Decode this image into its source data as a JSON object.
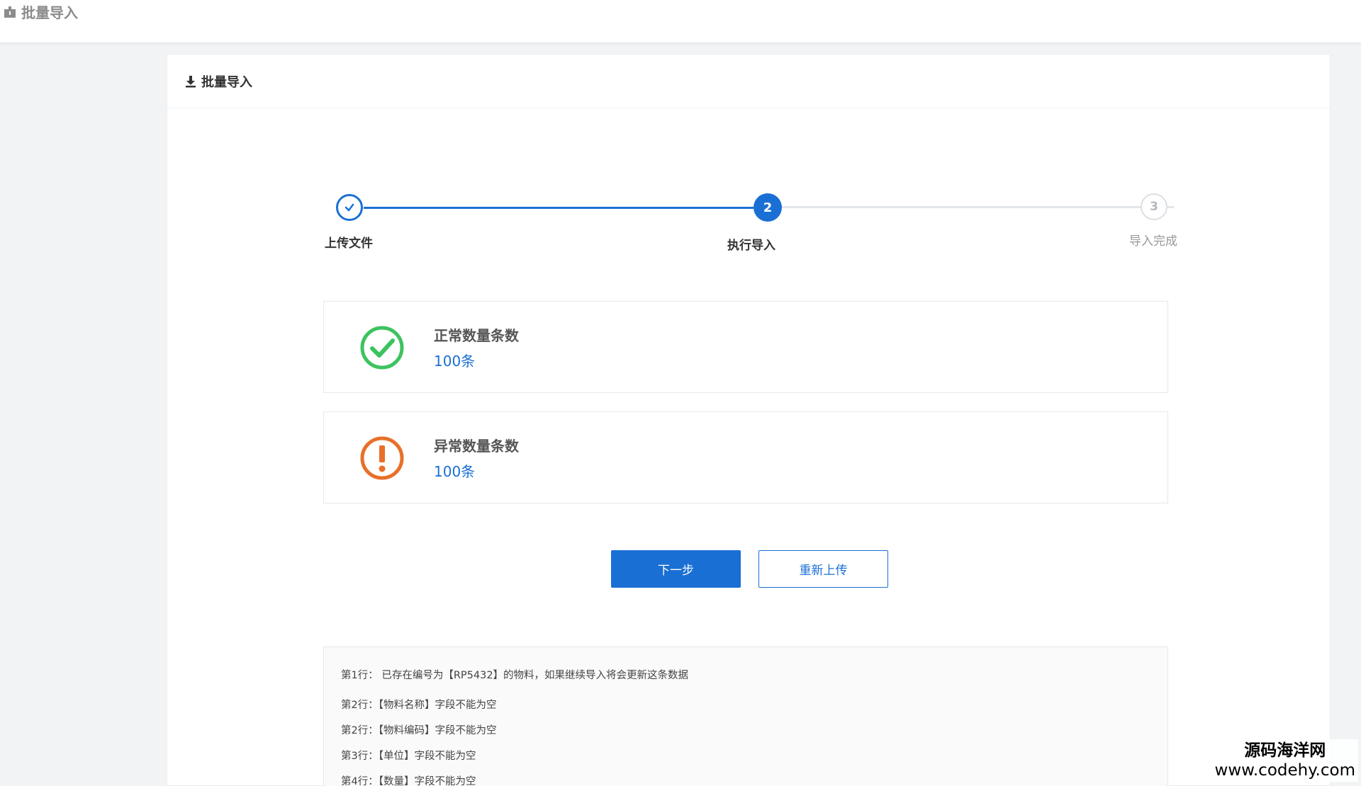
{
  "app": {
    "title": "批量导入"
  },
  "card": {
    "title": "批量导入"
  },
  "steps": [
    {
      "number": "1",
      "label": "上传文件",
      "status": "done"
    },
    {
      "number": "2",
      "label": "执行导入",
      "status": "active"
    },
    {
      "number": "3",
      "label": "导入完成",
      "status": "pending"
    }
  ],
  "results": {
    "normal": {
      "title": "正常数量条数",
      "value": "100条",
      "icon": "check-circle-icon",
      "color": "#3cc35f"
    },
    "abnormal": {
      "title": "异常数量条数",
      "value": "100条",
      "icon": "exclamation-circle-icon",
      "color": "#e8702a"
    }
  },
  "buttons": {
    "next_label": "下一步",
    "reupload_label": "重新上传"
  },
  "error_log": [
    "第1行：  已存在编号为【RP5432】的物料，如果继续导入将会更新这条数据",
    "第2行：【物料名称】字段不能为空",
    "第2行：【物料编码】字段不能为空",
    "第3行：【单位】字段不能为空",
    "第4行：【数量】字段不能为空"
  ],
  "watermark": {
    "line1": "源码海洋网",
    "line2": "www.codehy.com"
  },
  "colors": {
    "primary": "#1a6fd4",
    "success": "#3cc35f",
    "warning": "#e8702a"
  }
}
